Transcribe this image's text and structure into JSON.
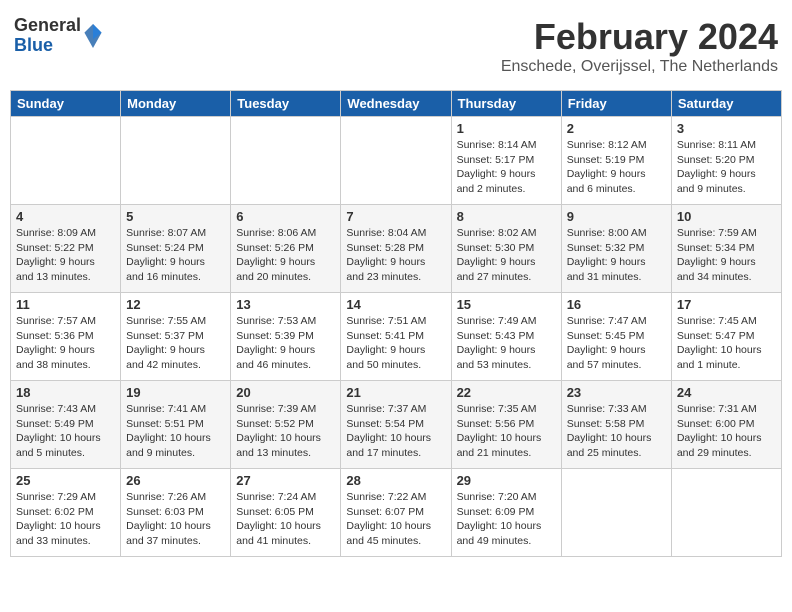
{
  "logo": {
    "general": "General",
    "blue": "Blue"
  },
  "title": "February 2024",
  "subtitle": "Enschede, Overijssel, The Netherlands",
  "days": [
    "Sunday",
    "Monday",
    "Tuesday",
    "Wednesday",
    "Thursday",
    "Friday",
    "Saturday"
  ],
  "weeks": [
    [
      {
        "day": "",
        "info": ""
      },
      {
        "day": "",
        "info": ""
      },
      {
        "day": "",
        "info": ""
      },
      {
        "day": "",
        "info": ""
      },
      {
        "day": "1",
        "info": "Sunrise: 8:14 AM\nSunset: 5:17 PM\nDaylight: 9 hours\nand 2 minutes."
      },
      {
        "day": "2",
        "info": "Sunrise: 8:12 AM\nSunset: 5:19 PM\nDaylight: 9 hours\nand 6 minutes."
      },
      {
        "day": "3",
        "info": "Sunrise: 8:11 AM\nSunset: 5:20 PM\nDaylight: 9 hours\nand 9 minutes."
      }
    ],
    [
      {
        "day": "4",
        "info": "Sunrise: 8:09 AM\nSunset: 5:22 PM\nDaylight: 9 hours\nand 13 minutes."
      },
      {
        "day": "5",
        "info": "Sunrise: 8:07 AM\nSunset: 5:24 PM\nDaylight: 9 hours\nand 16 minutes."
      },
      {
        "day": "6",
        "info": "Sunrise: 8:06 AM\nSunset: 5:26 PM\nDaylight: 9 hours\nand 20 minutes."
      },
      {
        "day": "7",
        "info": "Sunrise: 8:04 AM\nSunset: 5:28 PM\nDaylight: 9 hours\nand 23 minutes."
      },
      {
        "day": "8",
        "info": "Sunrise: 8:02 AM\nSunset: 5:30 PM\nDaylight: 9 hours\nand 27 minutes."
      },
      {
        "day": "9",
        "info": "Sunrise: 8:00 AM\nSunset: 5:32 PM\nDaylight: 9 hours\nand 31 minutes."
      },
      {
        "day": "10",
        "info": "Sunrise: 7:59 AM\nSunset: 5:34 PM\nDaylight: 9 hours\nand 34 minutes."
      }
    ],
    [
      {
        "day": "11",
        "info": "Sunrise: 7:57 AM\nSunset: 5:36 PM\nDaylight: 9 hours\nand 38 minutes."
      },
      {
        "day": "12",
        "info": "Sunrise: 7:55 AM\nSunset: 5:37 PM\nDaylight: 9 hours\nand 42 minutes."
      },
      {
        "day": "13",
        "info": "Sunrise: 7:53 AM\nSunset: 5:39 PM\nDaylight: 9 hours\nand 46 minutes."
      },
      {
        "day": "14",
        "info": "Sunrise: 7:51 AM\nSunset: 5:41 PM\nDaylight: 9 hours\nand 50 minutes."
      },
      {
        "day": "15",
        "info": "Sunrise: 7:49 AM\nSunset: 5:43 PM\nDaylight: 9 hours\nand 53 minutes."
      },
      {
        "day": "16",
        "info": "Sunrise: 7:47 AM\nSunset: 5:45 PM\nDaylight: 9 hours\nand 57 minutes."
      },
      {
        "day": "17",
        "info": "Sunrise: 7:45 AM\nSunset: 5:47 PM\nDaylight: 10 hours\nand 1 minute."
      }
    ],
    [
      {
        "day": "18",
        "info": "Sunrise: 7:43 AM\nSunset: 5:49 PM\nDaylight: 10 hours\nand 5 minutes."
      },
      {
        "day": "19",
        "info": "Sunrise: 7:41 AM\nSunset: 5:51 PM\nDaylight: 10 hours\nand 9 minutes."
      },
      {
        "day": "20",
        "info": "Sunrise: 7:39 AM\nSunset: 5:52 PM\nDaylight: 10 hours\nand 13 minutes."
      },
      {
        "day": "21",
        "info": "Sunrise: 7:37 AM\nSunset: 5:54 PM\nDaylight: 10 hours\nand 17 minutes."
      },
      {
        "day": "22",
        "info": "Sunrise: 7:35 AM\nSunset: 5:56 PM\nDaylight: 10 hours\nand 21 minutes."
      },
      {
        "day": "23",
        "info": "Sunrise: 7:33 AM\nSunset: 5:58 PM\nDaylight: 10 hours\nand 25 minutes."
      },
      {
        "day": "24",
        "info": "Sunrise: 7:31 AM\nSunset: 6:00 PM\nDaylight: 10 hours\nand 29 minutes."
      }
    ],
    [
      {
        "day": "25",
        "info": "Sunrise: 7:29 AM\nSunset: 6:02 PM\nDaylight: 10 hours\nand 33 minutes."
      },
      {
        "day": "26",
        "info": "Sunrise: 7:26 AM\nSunset: 6:03 PM\nDaylight: 10 hours\nand 37 minutes."
      },
      {
        "day": "27",
        "info": "Sunrise: 7:24 AM\nSunset: 6:05 PM\nDaylight: 10 hours\nand 41 minutes."
      },
      {
        "day": "28",
        "info": "Sunrise: 7:22 AM\nSunset: 6:07 PM\nDaylight: 10 hours\nand 45 minutes."
      },
      {
        "day": "29",
        "info": "Sunrise: 7:20 AM\nSunset: 6:09 PM\nDaylight: 10 hours\nand 49 minutes."
      },
      {
        "day": "",
        "info": ""
      },
      {
        "day": "",
        "info": ""
      }
    ]
  ]
}
